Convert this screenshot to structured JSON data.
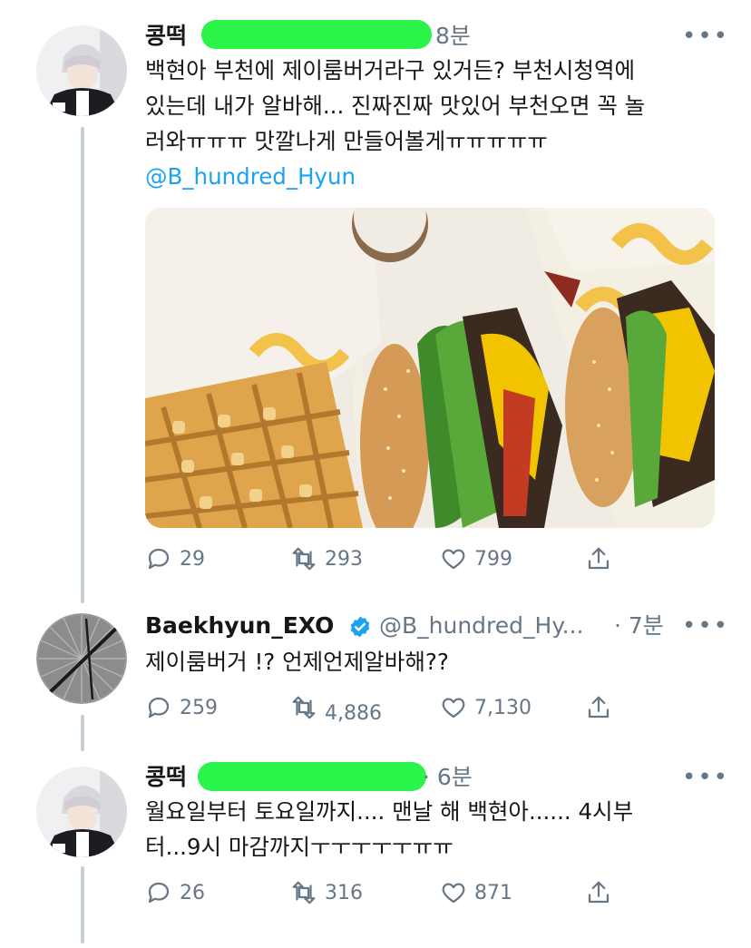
{
  "colors": {
    "accent": "#1da1f2",
    "muted": "#657786",
    "thread": "#c4cfd6",
    "redaction": "#2af34a",
    "verified": "#1da1f2"
  },
  "tweets": [
    {
      "name": "콩떡",
      "time": "8분",
      "more": "•••",
      "text_lines": [
        "백현아 부천에 제이룸버거라구 있거든? 부천시청역에",
        "있는데 내가 알바해... 진짜진짜 맛있어 부천오면 꼭 놀",
        "러와ㅠㅠㅠ 맛깔나게 만들어볼게ㅠㅠㅠㅠㅠ"
      ],
      "mention": "@B_hundred_Hyun",
      "image": "burgers-and-waffle-fries-photo",
      "replies": "29",
      "retweets": "293",
      "likes": "799"
    },
    {
      "name": "Baekhyun_EXO",
      "handle": "@B_hundred_Hy...",
      "time": "· 7분",
      "more": "•••",
      "verified": "verified-badge-icon",
      "text": "제이룸버거 !? 언제언제알바해??",
      "replies": "259",
      "retweets": "4,886",
      "likes": "7,130"
    },
    {
      "name": "콩떡",
      "time": "· 6분",
      "more": "•••",
      "text_lines": [
        "월요일부터 토요일까지.... 맨날 해 백현아...... 4시부",
        "터...9시 마감까지ㅜㅜㅜㅜㅜㅠㅠ"
      ],
      "replies": "26",
      "retweets": "316",
      "likes": "871"
    }
  ],
  "icons": {
    "reply": "reply-icon",
    "retweet": "retweet-icon",
    "like": "heart-icon",
    "share": "share-icon"
  }
}
